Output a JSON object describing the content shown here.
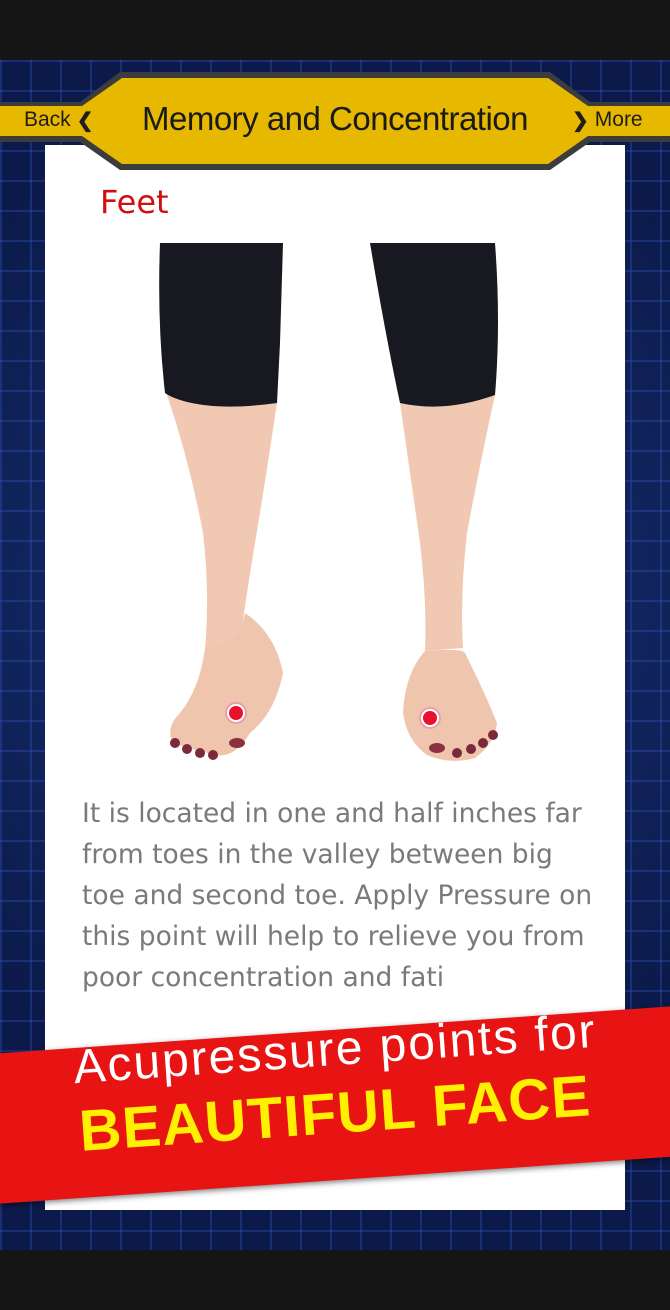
{
  "header": {
    "back_label": "Back",
    "more_label": "More",
    "title": "Memory and Concentration"
  },
  "content": {
    "section_title": "Feet",
    "description": "It is located in one and half inches far from toes in the valley between big toe and second toe. Apply Pressure on this point will help to relieve you from poor concentration and fati",
    "illustration_icon": "feet-acupressure-illustration",
    "marker_color": "#e8102a"
  },
  "banner": {
    "line1": "Acupressure points for",
    "line2": "BEAUTIFUL FACE"
  },
  "colors": {
    "header_gold": "#e6b800",
    "banner_red": "#e81414",
    "banner_yellow": "#ffef00",
    "section_title_red": "#d01010",
    "background_navy": "#0b1a4a"
  }
}
